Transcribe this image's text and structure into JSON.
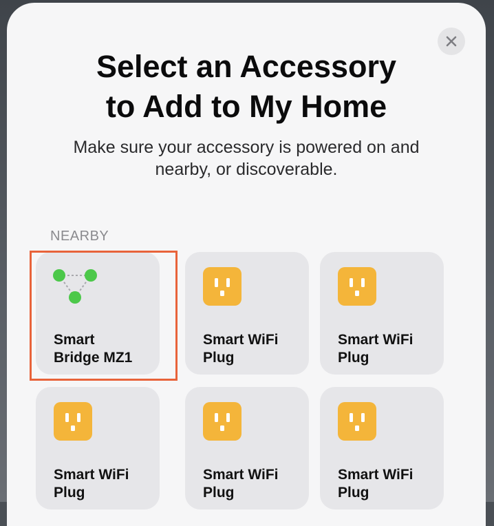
{
  "header": {
    "close_glyph": "✕",
    "title_line1": "Select an Accessory",
    "title_line2": "to Add to My Home",
    "subtitle_line1": "Make sure your accessory is powered on and",
    "subtitle_line2": "nearby, or discoverable."
  },
  "section": {
    "label": "NEARBY"
  },
  "accessories": [
    {
      "line1": "Smart",
      "line2": "Bridge MZ1",
      "icon": "bridge-icon",
      "selected": true
    },
    {
      "line1": "Smart WiFi",
      "line2": "Plug",
      "icon": "plug-icon"
    },
    {
      "line1": "Smart WiFi",
      "line2": "Plug",
      "icon": "plug-icon"
    },
    {
      "line1": "Smart WiFi",
      "line2": "Plug",
      "icon": "plug-icon"
    },
    {
      "line1": "Smart WiFi",
      "line2": "Plug",
      "icon": "plug-icon"
    },
    {
      "line1": "Smart WiFi",
      "line2": "Plug",
      "icon": "plug-icon"
    }
  ],
  "colors": {
    "plug_yellow": "#f4b53a",
    "bridge_green": "#4cc84a",
    "selection_orange": "#e8633a"
  }
}
